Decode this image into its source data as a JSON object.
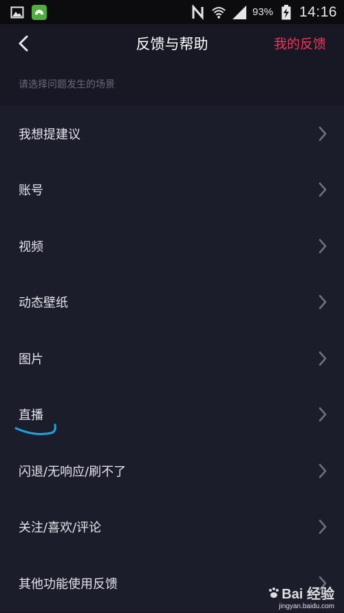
{
  "status_bar": {
    "icons_left": [
      "gallery-icon",
      "app-notification-icon"
    ],
    "icons_right": [
      "nfc-icon",
      "wifi-icon",
      "signal-icon",
      "battery-icon"
    ],
    "battery": "93%",
    "time": "14:16"
  },
  "header": {
    "back_icon": "chevron-left-icon",
    "title": "反馈与帮助",
    "right_action": "我的反馈",
    "accent_color": "#f2335a"
  },
  "section_hint": "请选择问题发生的场景",
  "items": [
    {
      "label": "我想提建议"
    },
    {
      "label": "账号"
    },
    {
      "label": "视频"
    },
    {
      "label": "动态壁纸"
    },
    {
      "label": "图片"
    },
    {
      "label": "直播"
    },
    {
      "label": "闪退/无响应/刷不了"
    },
    {
      "label": "关注/喜欢/评论"
    },
    {
      "label": "其他功能使用反馈"
    }
  ],
  "watermark": {
    "brand": "Bai 经验",
    "url": "jingyan.baidu.com"
  }
}
